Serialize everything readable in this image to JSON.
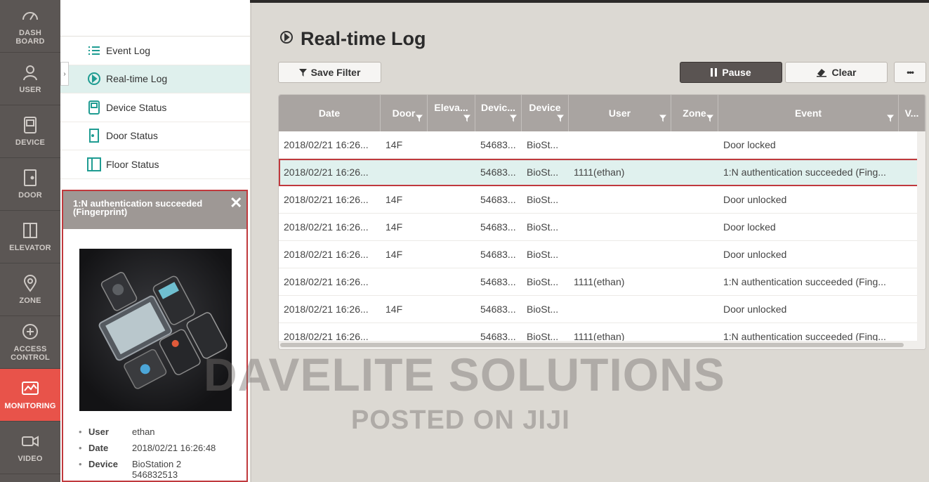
{
  "rail": [
    {
      "label": "DASH\nBOARD",
      "icon": "gauge-icon"
    },
    {
      "label": "USER",
      "icon": "user-icon"
    },
    {
      "label": "DEVICE",
      "icon": "device-icon"
    },
    {
      "label": "DOOR",
      "icon": "door-icon"
    },
    {
      "label": "ELEVATOR",
      "icon": "elevator-icon"
    },
    {
      "label": "ZONE",
      "icon": "location-pin-icon"
    },
    {
      "label": "ACCESS\nCONTROL",
      "icon": "access-control-icon"
    },
    {
      "label": "MONITORING",
      "icon": "monitoring-icon",
      "active": true
    },
    {
      "label": "VIDEO",
      "icon": "video-camera-icon"
    }
  ],
  "submenu": [
    {
      "label": "Event Log",
      "icon": "list-icon"
    },
    {
      "label": "Real-time Log",
      "icon": "play-circle-icon",
      "active": true
    },
    {
      "label": "Device Status",
      "icon": "device-status-icon"
    },
    {
      "label": "Door Status",
      "icon": "door-status-icon"
    },
    {
      "label": "Floor Status",
      "icon": "floor-status-icon"
    }
  ],
  "popup": {
    "title": "1:N authentication succeeded (Fingerprint)",
    "details": [
      {
        "key": "User",
        "value": "ethan"
      },
      {
        "key": "Date",
        "value": "2018/02/21 16:26:48"
      },
      {
        "key": "Device",
        "value": "BioStation 2\n546832513"
      }
    ]
  },
  "main": {
    "title": "Real-time Log",
    "buttons": {
      "save_filter": "Save Filter",
      "pause": "Pause",
      "clear": "Clear",
      "more": "•••"
    }
  },
  "grid": {
    "columns": [
      "Date",
      "Door",
      "Eleva...",
      "Devic...",
      "Device",
      "User",
      "Zone",
      "Event",
      "V..."
    ],
    "rows": [
      [
        "2018/02/21 16:26...",
        "14F",
        "",
        "54683...",
        "BioSt...",
        "",
        "",
        "Door locked"
      ],
      [
        "2018/02/21 16:26...",
        "",
        "",
        "54683...",
        "BioSt...",
        "1111(ethan)",
        "",
        "1:N authentication succeeded (Fing..."
      ],
      [
        "2018/02/21 16:26...",
        "14F",
        "",
        "54683...",
        "BioSt...",
        "",
        "",
        "Door unlocked"
      ],
      [
        "2018/02/21 16:26...",
        "14F",
        "",
        "54683...",
        "BioSt...",
        "",
        "",
        "Door locked"
      ],
      [
        "2018/02/21 16:26...",
        "14F",
        "",
        "54683...",
        "BioSt...",
        "",
        "",
        "Door unlocked"
      ],
      [
        "2018/02/21 16:26...",
        "",
        "",
        "54683...",
        "BioSt...",
        "1111(ethan)",
        "",
        "1:N authentication succeeded (Fing..."
      ],
      [
        "2018/02/21 16:26...",
        "14F",
        "",
        "54683...",
        "BioSt...",
        "",
        "",
        "Door unlocked"
      ],
      [
        "2018/02/21 16:26...",
        "",
        "",
        "54683...",
        "BioSt...",
        "1111(ethan)",
        "",
        "1:N authentication succeeded (Fing..."
      ]
    ],
    "selected_row": 1
  },
  "watermark": {
    "line1": "DAVELITE SOLUTIONS",
    "line2": "POSTED ON JIJI"
  },
  "colors": {
    "accent": "#e8534a",
    "teal": "#1f9c92",
    "highlight": "#c0393d"
  }
}
